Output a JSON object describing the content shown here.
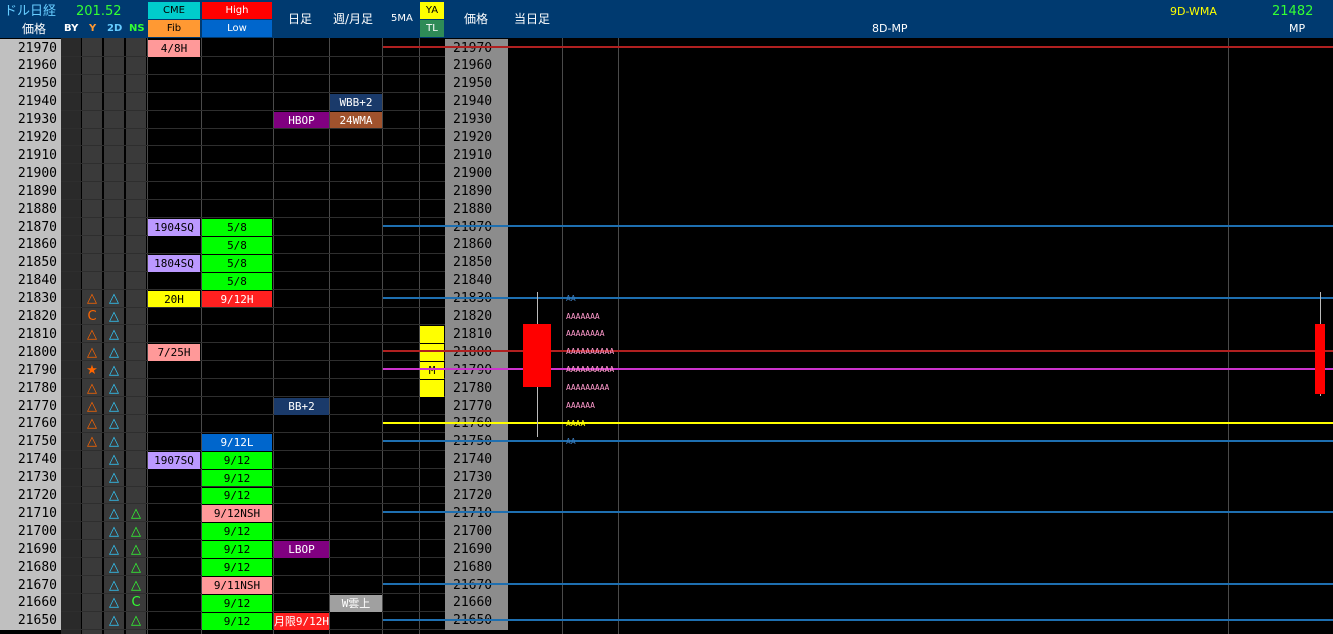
{
  "header": {
    "title": "ドル日経",
    "usd_price": "201.52",
    "price_label": "価格",
    "by": "BY",
    "y": "Y",
    "d2": "2D",
    "ns": "NS",
    "cme": "CME",
    "fib": "Fib",
    "high": "High",
    "low": "Low",
    "daily": "日足",
    "weekly_monthly": "週/月足",
    "ma5": "5MA",
    "ya": "YA",
    "tl": "TL",
    "price_label2": "価格",
    "today": "当日足",
    "mp8d": "8D-MP",
    "wma9d": "9D-WMA",
    "wma_value": "21482",
    "mp": "MP"
  },
  "prices": [
    "21970",
    "21960",
    "21950",
    "21940",
    "21930",
    "21920",
    "21910",
    "21900",
    "21890",
    "21880",
    "21870",
    "21860",
    "21850",
    "21840",
    "21830",
    "21820",
    "21810",
    "21800",
    "21790",
    "21780",
    "21770",
    "21760",
    "21750",
    "21740",
    "21730",
    "21720",
    "21710",
    "21700",
    "21690",
    "21680",
    "21670",
    "21660",
    "21650"
  ],
  "markers": {
    "y_col": [
      {
        "row": 14,
        "sym": "△",
        "color": "#ff6600"
      },
      {
        "row": 15,
        "sym": "C",
        "color": "#ff6600"
      },
      {
        "row": 16,
        "sym": "△",
        "color": "#ff6600"
      },
      {
        "row": 17,
        "sym": "△",
        "color": "#ff6600"
      },
      {
        "row": 18,
        "sym": "★",
        "color": "#ff6600"
      },
      {
        "row": 19,
        "sym": "△",
        "color": "#ff6600"
      },
      {
        "row": 20,
        "sym": "△",
        "color": "#ff6600"
      },
      {
        "row": 21,
        "sym": "△",
        "color": "#ff6600"
      },
      {
        "row": 22,
        "sym": "△",
        "color": "#ff6600"
      }
    ],
    "d2_col": [
      {
        "row": 14
      },
      {
        "row": 15
      },
      {
        "row": 16
      },
      {
        "row": 17
      },
      {
        "row": 18
      },
      {
        "row": 19
      },
      {
        "row": 20
      },
      {
        "row": 21
      },
      {
        "row": 22
      },
      {
        "row": 23
      },
      {
        "row": 24
      },
      {
        "row": 25
      },
      {
        "row": 26
      },
      {
        "row": 27
      },
      {
        "row": 28
      },
      {
        "row": 29
      },
      {
        "row": 30
      },
      {
        "row": 31
      },
      {
        "row": 32
      }
    ],
    "ns_col": [
      {
        "row": 26,
        "sym": "△"
      },
      {
        "row": 27,
        "sym": "△"
      },
      {
        "row": 28,
        "sym": "△"
      },
      {
        "row": 29,
        "sym": "△"
      },
      {
        "row": 30,
        "sym": "△"
      },
      {
        "row": 31,
        "sym": "C"
      },
      {
        "row": 32,
        "sym": "△"
      }
    ]
  },
  "cme_cells": [
    {
      "row": 0,
      "text": "4/8H",
      "bg": "#ff9999",
      "fg": "#000"
    },
    {
      "row": 10,
      "text": "1904SQ",
      "bg": "#bb99ff",
      "fg": "#000"
    },
    {
      "row": 12,
      "text": "1804SQ",
      "bg": "#bb99ff",
      "fg": "#000"
    },
    {
      "row": 14,
      "text": "20H",
      "bg": "#ffff00",
      "fg": "#000"
    },
    {
      "row": 17,
      "text": "7/25H",
      "bg": "#ff9999",
      "fg": "#000"
    },
    {
      "row": 23,
      "text": "1907SQ",
      "bg": "#bb99ff",
      "fg": "#000"
    }
  ],
  "hl_cells": [
    {
      "row": 10,
      "text": "5/8",
      "bg": "#00ff00",
      "fg": "#000"
    },
    {
      "row": 11,
      "text": "5/8",
      "bg": "#00ff00",
      "fg": "#000"
    },
    {
      "row": 12,
      "text": "5/8",
      "bg": "#00ff00",
      "fg": "#000"
    },
    {
      "row": 13,
      "text": "5/8",
      "bg": "#00ff00",
      "fg": "#000"
    },
    {
      "row": 14,
      "text": "9/12H",
      "bg": "#ff2020",
      "fg": "#fff"
    },
    {
      "row": 22,
      "text": "9/12L",
      "bg": "#0066cc",
      "fg": "#fff"
    },
    {
      "row": 23,
      "text": "9/12",
      "bg": "#00ff00",
      "fg": "#000"
    },
    {
      "row": 24,
      "text": "9/12",
      "bg": "#00ff00",
      "fg": "#000"
    },
    {
      "row": 25,
      "text": "9/12",
      "bg": "#00ff00",
      "fg": "#000"
    },
    {
      "row": 26,
      "text": "9/12NSH",
      "bg": "#ff9999",
      "fg": "#000"
    },
    {
      "row": 27,
      "text": "9/12",
      "bg": "#00ff00",
      "fg": "#000"
    },
    {
      "row": 28,
      "text": "9/12",
      "bg": "#00ff00",
      "fg": "#000"
    },
    {
      "row": 29,
      "text": "9/12",
      "bg": "#00ff00",
      "fg": "#000"
    },
    {
      "row": 30,
      "text": "9/11NSH",
      "bg": "#ff9999",
      "fg": "#000"
    },
    {
      "row": 31,
      "text": "9/12",
      "bg": "#00ff00",
      "fg": "#000"
    },
    {
      "row": 32,
      "text": "9/12",
      "bg": "#00ff00",
      "fg": "#000"
    }
  ],
  "daily_cells": [
    {
      "row": 4,
      "text": "HBOP",
      "bg": "#800080",
      "fg": "#fff"
    },
    {
      "row": 20,
      "text": "BB+2",
      "bg": "#1a3a6a",
      "fg": "#fff"
    },
    {
      "row": 28,
      "text": "LBOP",
      "bg": "#800080",
      "fg": "#fff"
    },
    {
      "row": 32,
      "text": "月限9/12H",
      "bg": "#ff2020",
      "fg": "#fff"
    }
  ],
  "weekly_cells": [
    {
      "row": 3,
      "text": "WBB+2",
      "bg": "#1a3a6a",
      "fg": "#fff"
    },
    {
      "row": 4,
      "text": "24WMA",
      "bg": "#a0522d",
      "fg": "#fff"
    },
    {
      "row": 31,
      "text": "W雲上",
      "bg": "#a0a0a0",
      "fg": "#fff"
    }
  ],
  "ya_cells": [
    {
      "row": 16,
      "text": "",
      "bg": "#ffff00",
      "fg": "#000"
    },
    {
      "row": 17,
      "text": "",
      "bg": "#ffff00",
      "fg": "#000"
    },
    {
      "row": 18,
      "text": "M",
      "bg": "#ffff00",
      "fg": "#000"
    },
    {
      "row": 19,
      "text": "",
      "bg": "#ffff00",
      "fg": "#000"
    }
  ],
  "market_profile": [
    {
      "row": 14,
      "text": "AA",
      "color": "#3d7ab8"
    },
    {
      "row": 15,
      "text": "AAAAAAA",
      "color": "#ff99cc"
    },
    {
      "row": 16,
      "text": "AAAAAAAA",
      "color": "#ff99cc"
    },
    {
      "row": 17,
      "text": "AAAAAAAAAA",
      "color": "#ff99cc"
    },
    {
      "row": 18,
      "text": "AAAAAAAAAA",
      "color": "#ff99cc"
    },
    {
      "row": 19,
      "text": "AAAAAAAAA",
      "color": "#ff99cc"
    },
    {
      "row": 20,
      "text": "AAAAAA",
      "color": "#ff99cc"
    },
    {
      "row": 21,
      "text": "AAAA",
      "color": "#ffff00"
    },
    {
      "row": 22,
      "text": "AA",
      "color": "#3d7ab8"
    }
  ],
  "level_lines": [
    {
      "price": 21970,
      "color": "#b02020"
    },
    {
      "price": 21870,
      "color": "#1e6fb0"
    },
    {
      "price": 21830,
      "color": "#1e6fb0"
    },
    {
      "price": 21800,
      "color": "#b02020"
    },
    {
      "price": 21790,
      "color": "#cc33cc"
    },
    {
      "price": 21760,
      "color": "#ffff00"
    },
    {
      "price": 21750,
      "color": "#1e6fb0"
    },
    {
      "price": 21710,
      "color": "#1e6fb0"
    },
    {
      "price": 21670,
      "color": "#1e6fb0"
    },
    {
      "price": 21650,
      "color": "#1e6fb0"
    }
  ],
  "candles": [
    {
      "high": 21833,
      "low": 21752,
      "open": 21815,
      "close": 21780,
      "color": "#ff0000"
    },
    {
      "high": 21833,
      "low": 21775,
      "open": 21815,
      "close": 21776,
      "color": "#ff0000"
    }
  ]
}
